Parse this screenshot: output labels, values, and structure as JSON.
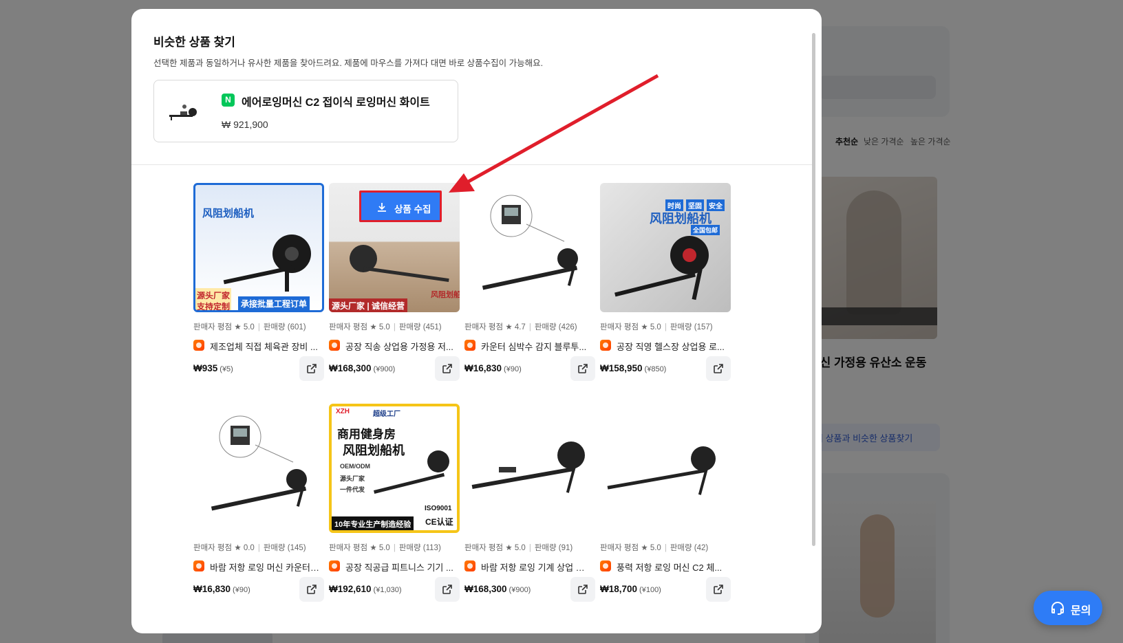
{
  "background": {
    "sort_options": [
      "추천순",
      "낮은 가격순",
      "높은 가격순"
    ],
    "product_title_fragment": "머신 가정용 유산소 운동",
    "similar_button_fragment": "이 상품과 비슷한 상품찾기"
  },
  "modal": {
    "title": "비슷한 상품 찾기",
    "description": "선택한 제품과 동일하거나 유사한 제품을 찾아드려요. 제품에 마우스를 가져다 대면 바로 상품수집이 가능해요.",
    "source_product": {
      "badge": "N",
      "name": "에어로잉머신 C2 접이식 로잉머신 화이트",
      "price": "₩ 921,900"
    },
    "collect_button_label": "상품 수집",
    "products": [
      {
        "rating_label": "판매자 평점",
        "rating": "5.0",
        "sales_label": "판매량",
        "sales": "(601)",
        "title": "제조업체 직접 체육관 장비 ...",
        "price": "₩935",
        "price_cny": "(¥5)",
        "img_text": [
          "风阻划船机",
          "源头厂家",
          "支持定制",
          "承接批量工程订单"
        ]
      },
      {
        "rating_label": "판매자 평점",
        "rating": "5.0",
        "sales_label": "판매량",
        "sales": "(451)",
        "title": "공장 직송 상업용 가정용 저...",
        "price": "₩168,300",
        "price_cny": "(¥900)",
        "img_text": [
          "源头厂家 | 诚信经营",
          "风阻划船机"
        ]
      },
      {
        "rating_label": "판매자 평점",
        "rating": "4.7",
        "sales_label": "판매량",
        "sales": "(426)",
        "title": "카운터 심박수 감지 블루투...",
        "price": "₩16,830",
        "price_cny": "(¥90)",
        "img_text": []
      },
      {
        "rating_label": "판매자 평점",
        "rating": "5.0",
        "sales_label": "판매량",
        "sales": "(157)",
        "title": "공장 직영 헬스장 상업용 로...",
        "price": "₩158,950",
        "price_cny": "(¥850)",
        "img_text": [
          "时尚",
          "坚固",
          "安全",
          "风阻划船机",
          "全国包邮"
        ]
      },
      {
        "rating_label": "판매자 평점",
        "rating": "0.0",
        "sales_label": "판매량",
        "sales": "(145)",
        "title": "바람 저항 로잉 머신 카운터 ...",
        "price": "₩16,830",
        "price_cny": "(¥90)",
        "img_text": []
      },
      {
        "rating_label": "판매자 평점",
        "rating": "5.0",
        "sales_label": "판매량",
        "sales": "(113)",
        "title": "공장 직공급 피트니스 기기 ...",
        "price": "₩192,610",
        "price_cny": "(¥1,030)",
        "img_text": [
          "XZH",
          "超级工厂",
          "商用健身房",
          "风阻划船机",
          "OEM/ODM",
          "源头厂家",
          "一件代发",
          "ISO9001",
          "10年专业生产制造经验",
          "CE认证"
        ]
      },
      {
        "rating_label": "판매자 평점",
        "rating": "5.0",
        "sales_label": "판매량",
        "sales": "(91)",
        "title": "바람 저항 로잉 기계 상업 홈...",
        "price": "₩168,300",
        "price_cny": "(¥900)",
        "img_text": []
      },
      {
        "rating_label": "판매자 평점",
        "rating": "5.0",
        "sales_label": "판매량",
        "sales": "(42)",
        "title": "풍력 저항 로잉 머신 C2 체...",
        "price": "₩18,700",
        "price_cny": "(¥100)",
        "img_text": []
      }
    ]
  },
  "inquiry_button_label": "문의",
  "colors": {
    "accent": "#2f7bf5",
    "highlight_border": "#e01e2b",
    "naver_green": "#03c75a",
    "annotation_arrow": "#e01e2b"
  }
}
